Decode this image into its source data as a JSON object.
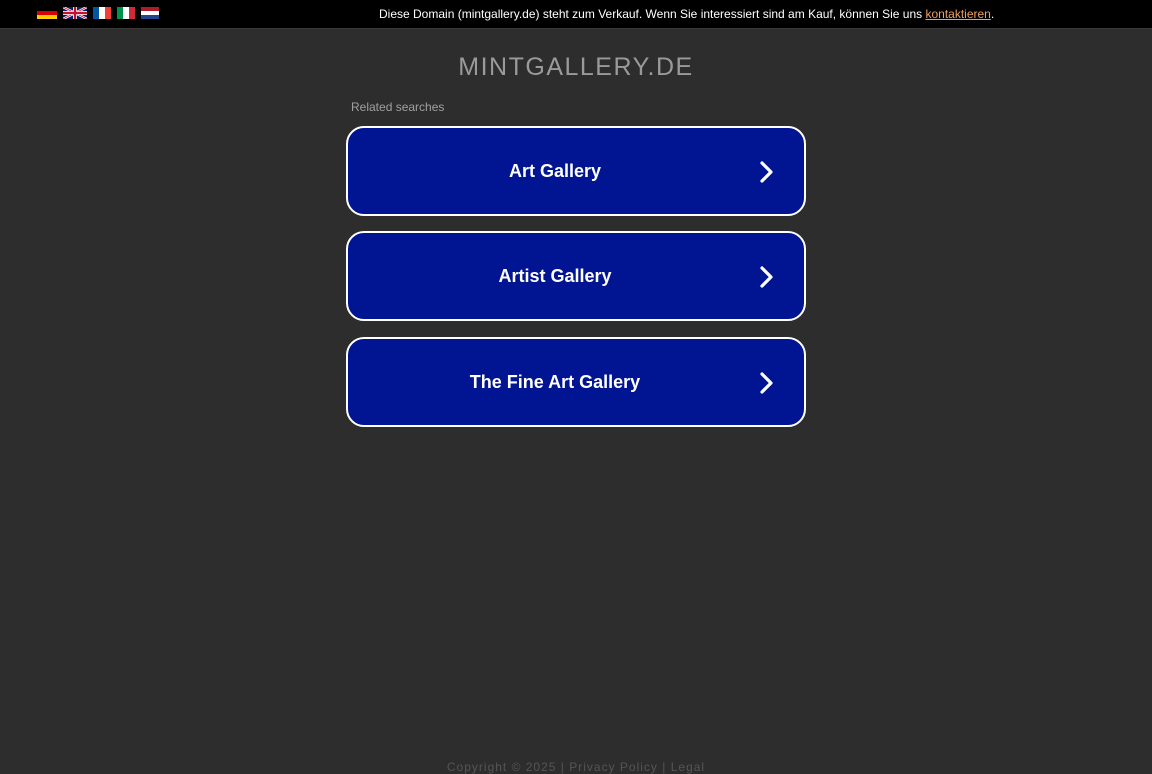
{
  "header": {
    "flags": [
      {
        "name": "flag-de-icon",
        "lang": "German"
      },
      {
        "name": "flag-en-icon",
        "lang": "English"
      },
      {
        "name": "flag-fr-icon",
        "lang": "French"
      },
      {
        "name": "flag-it-icon",
        "lang": "Italian"
      },
      {
        "name": "flag-nl-icon",
        "lang": "Dutch"
      }
    ],
    "notice_text": "Diese Domain (mintgallery.de) steht zum Verkauf. Wenn Sie interessiert sind am Kauf, können Sie uns ",
    "notice_link": "kontaktieren",
    "notice_end": "."
  },
  "main": {
    "domain": "MINTGALLERY.DE",
    "related_label": "Related searches",
    "searches": [
      {
        "label": "Art Gallery"
      },
      {
        "label": "Artist Gallery"
      },
      {
        "label": "The Fine Art Gallery"
      }
    ]
  },
  "footer": {
    "copyright": "Copyright © 2025",
    "sep1": " | ",
    "privacy": "Privacy Policy",
    "sep2": " | ",
    "legal": "Legal"
  },
  "colors": {
    "background": "#2d2d2d",
    "topbar": "#000000",
    "button_fill": "#011593",
    "button_border": "#ffffff",
    "link": "#f0a15e"
  }
}
